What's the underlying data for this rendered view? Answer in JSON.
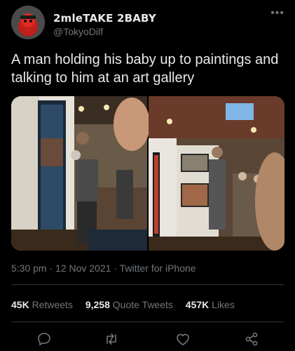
{
  "tweet": {
    "display_name": "2mleTAKE 2BABY",
    "handle": "@TokyoDilf",
    "text": "A man holding his baby up to paintings and talking to him at an art gallery",
    "timestamp": "5:30 pm · 12 Nov 2021",
    "source": "Twitter for iPhone",
    "stats": {
      "retweets_count": "45K",
      "retweets_label": "Retweets",
      "quotes_count": "9,258",
      "quotes_label": "Quote Tweets",
      "likes_count": "457K",
      "likes_label": "Likes"
    }
  },
  "icons": [
    "more-icon",
    "reply-icon",
    "retweet-icon",
    "like-icon",
    "share-icon"
  ],
  "colors": {
    "background": "#000000",
    "text": "#e7e9ea",
    "secondary": "#71767b",
    "divider": "#2f3336"
  }
}
